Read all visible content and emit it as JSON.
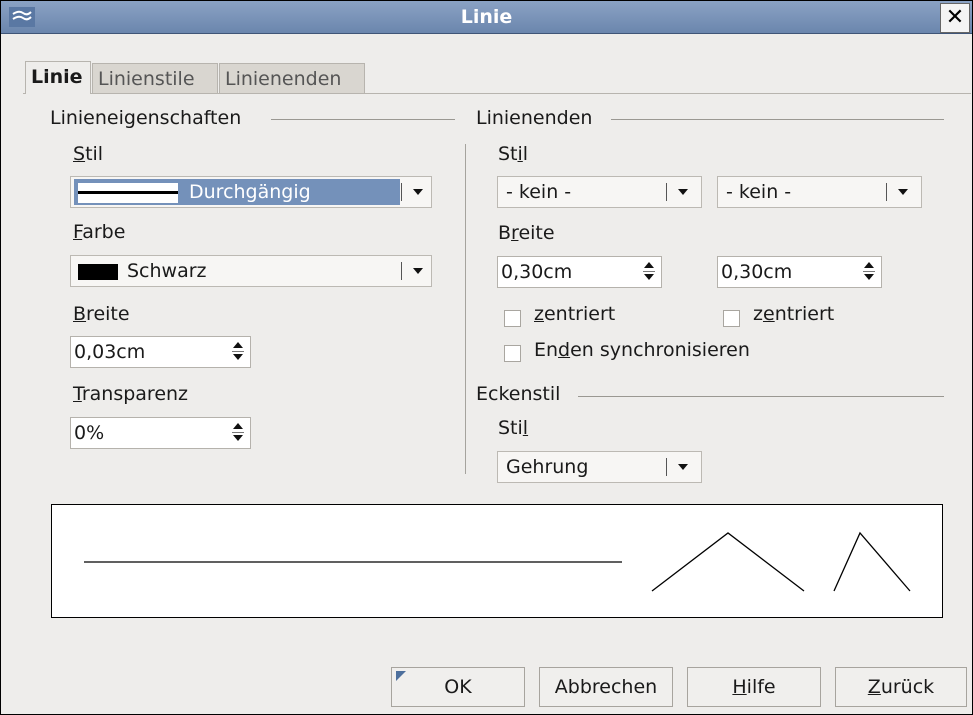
{
  "window": {
    "title": "Linie"
  },
  "tabs": [
    "Linie",
    "Linienstile",
    "Linienenden"
  ],
  "line_props": {
    "title": "Linieneigenschaften",
    "style_label_rest": "til",
    "style_label_key": "S",
    "style_value": "Durchgängig",
    "color_label_key": "F",
    "color_label_rest": "arbe",
    "color_value": "Schwarz",
    "color_swatch": "#000000",
    "width_label_key": "B",
    "width_label_rest": "reite",
    "width_value": "0,03cm",
    "transparency_label_key": "T",
    "transparency_label_rest": "ransparenz",
    "transparency_value": "0%"
  },
  "line_ends": {
    "title": "Linienenden",
    "style_label_pre": "St",
    "style_label_key": "i",
    "style_label_post": "l",
    "start_style": "- kein -",
    "end_style": "- kein -",
    "width_label_pre": "B",
    "width_label_key": "r",
    "width_label_post": "eite",
    "start_width": "0,30cm",
    "end_width": "0,30cm",
    "centered1_key": "z",
    "centered1_rest": "entriert",
    "centered2_pre": "z",
    "centered2_key": "e",
    "centered2_post": "ntriert",
    "sync_pre": "En",
    "sync_key": "d",
    "sync_post": "en synchronisieren"
  },
  "corner": {
    "title": "Eckenstil",
    "style_label_pre": "Sti",
    "style_label_key": "l",
    "style_value": "Gehrung"
  },
  "buttons": {
    "ok": "OK",
    "cancel": "Abbrechen",
    "help_key": "H",
    "help_rest": "ilfe",
    "back_key": "Z",
    "back_rest": "urück"
  },
  "colors": {
    "accent": "#7491ba",
    "title_bar": "#7a93b8"
  }
}
